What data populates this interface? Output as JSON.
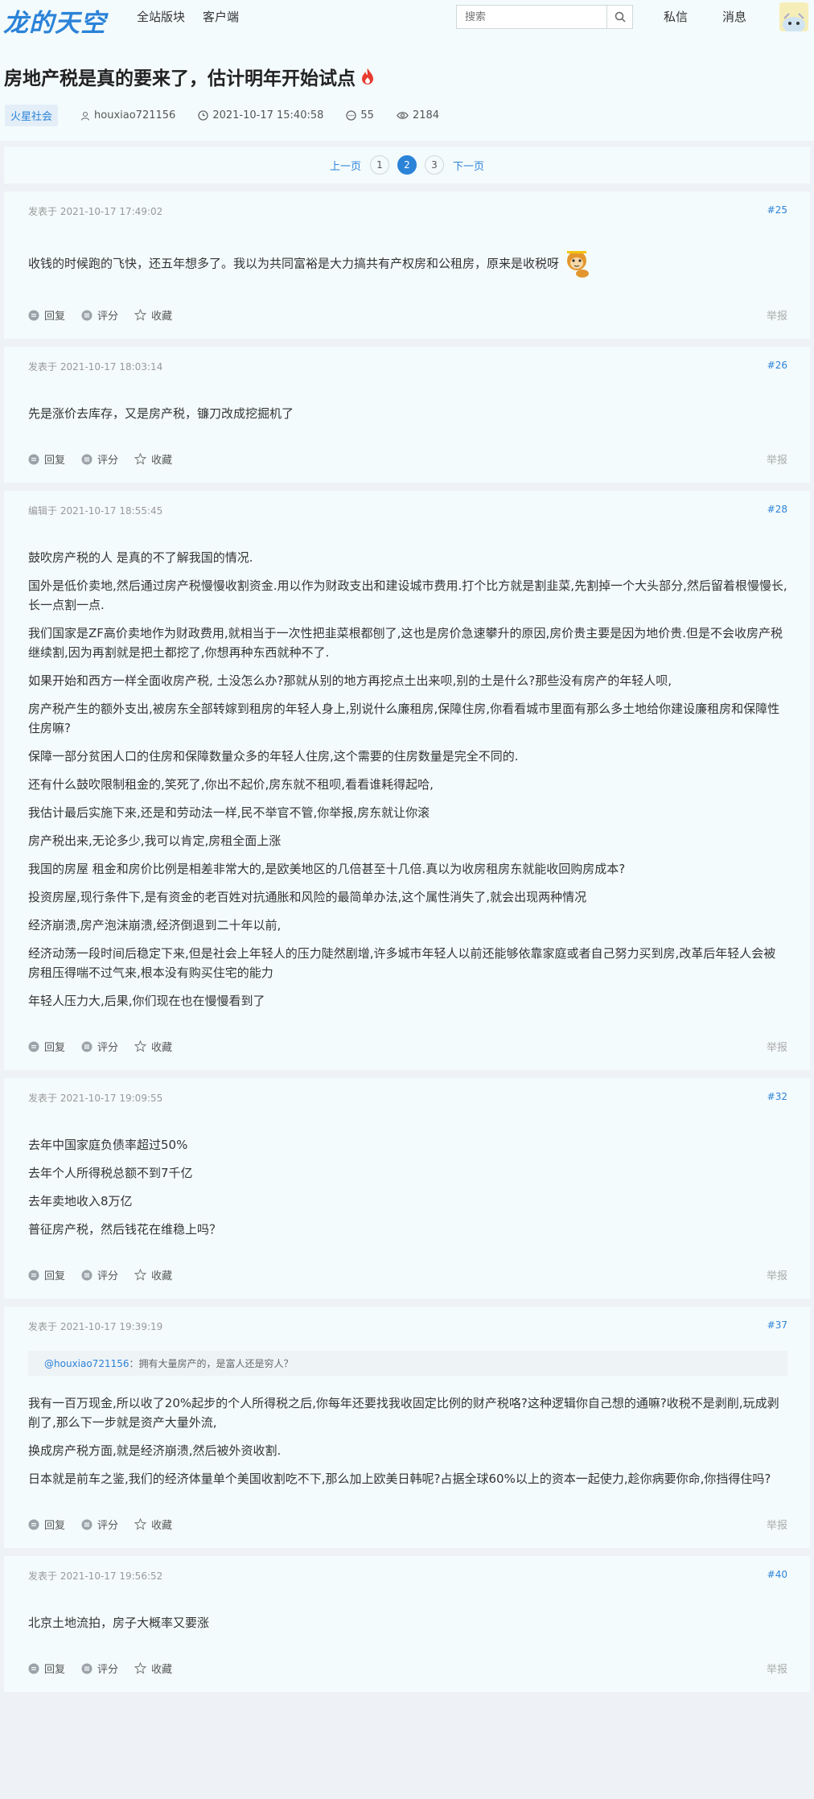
{
  "header": {
    "logo": "龙的天空",
    "nav": [
      "全站版块",
      "客户端"
    ],
    "search_placeholder": "搜索",
    "messages_private": "私信",
    "messages": "消息"
  },
  "thread": {
    "title": "房地产税是真的要来了，估计明年开始试点",
    "tag": "火星社会",
    "author": "houxiao721156",
    "date": "2021-10-17 15:40:58",
    "replies": "55",
    "views": "2184"
  },
  "pager": {
    "prev": "上一页",
    "pages": [
      "1",
      "2",
      "3"
    ],
    "current": "2",
    "next": "下一页"
  },
  "actions": {
    "reply": "回复",
    "rate": "评分",
    "fav": "收藏",
    "report": "举报"
  },
  "posts": [
    {
      "time": "发表于 2021-10-17 17:49:02",
      "floor": "#25",
      "lines": [
        "收钱的时候跑的飞快，还五年想多了。我以为共同富裕是大力搞共有产权房和公租房，原来是收税呀"
      ]
    },
    {
      "time": "发表于 2021-10-17 18:03:14",
      "floor": "#26",
      "lines": [
        "先是涨价去库存，又是房产税，镰刀改成挖掘机了"
      ]
    },
    {
      "time": "编辑于 2021-10-17 18:55:45",
      "floor": "#28",
      "lines": [
        "鼓吹房产税的人 是真的不了解我国的情况.",
        "国外是低价卖地,然后通过房产税慢慢收割资金.用以作为财政支出和建设城市费用.打个比方就是割韭菜,先割掉一个大头部分,然后留着根慢慢长,长一点割一点.",
        "我们国家是ZF高价卖地作为财政费用,就相当于一次性把韭菜根都刨了,这也是房价急速攀升的原因,房价贵主要是因为地价贵.但是不会收房产税继续割,因为再割就是把土都挖了,你想再种东西就种不了.",
        "如果开始和西方一样全面收房产税, 土没怎么办?那就从别的地方再挖点土出来呗,别的土是什么?那些没有房产的年轻人呗,",
        "房产税产生的额外支出,被房东全部转嫁到租房的年轻人身上,别说什么廉租房,保障住房,你看看城市里面有那么多土地给你建设廉租房和保障性住房嘛?",
        "保障一部分贫困人口的住房和保障数量众多的年轻人住房,这个需要的住房数量是完全不同的.",
        "还有什么鼓吹限制租金的,笑死了,你出不起价,房东就不租呗,看看谁耗得起哈,",
        "我估计最后实施下来,还是和劳动法一样,民不举官不管,你举报,房东就让你滚",
        "房产税出来,无论多少,我可以肯定,房租全面上涨",
        "我国的房屋 租金和房价比例是相差非常大的,是欧美地区的几倍甚至十几倍.真以为收房租房东就能收回购房成本?",
        "投资房屋,现行条件下,是有资金的老百姓对抗通胀和风险的最简单办法,这个属性消失了,就会出现两种情况",
        "经济崩溃,房产泡沫崩溃,经济倒退到二十年以前,",
        "经济动荡一段时间后稳定下来,但是社会上年轻人的压力陡然剧增,许多城市年轻人以前还能够依靠家庭或者自己努力买到房,改革后年轻人会被房租压得喘不过气来,根本没有购买住宅的能力",
        "年轻人压力大,后果,你们现在也在慢慢看到了"
      ]
    },
    {
      "time": "发表于 2021-10-17 19:09:55",
      "floor": "#32",
      "lines": [
        "去年中国家庭负债率超过50%",
        "去年个人所得税总额不到7千亿",
        "去年卖地收入8万亿",
        "普征房产税，然后钱花在维稳上吗？"
      ]
    },
    {
      "time": "发表于 2021-10-17 19:39:19",
      "floor": "#37",
      "quote_user": "@houxiao721156",
      "quote_text": "：拥有大量房产的，是富人还是穷人？",
      "lines": [
        "我有一百万现金,所以收了20%起步的个人所得税之后,你每年还要找我收固定比例的财产税咯?这种逻辑你自己想的通嘛?收税不是剥削,玩成剥削了,那么下一步就是资产大量外流,",
        "换成房产税方面,就是经济崩溃,然后被外资收割.",
        "日本就是前车之鉴,我们的经济体量单个美国收割吃不下,那么加上欧美日韩呢?占据全球60%以上的资本一起使力,趁你病要你命,你挡得住吗?"
      ]
    },
    {
      "time": "发表于 2021-10-17 19:56:52",
      "floor": "#40",
      "lines": [
        "北京土地流拍，房子大概率又要涨"
      ]
    }
  ]
}
